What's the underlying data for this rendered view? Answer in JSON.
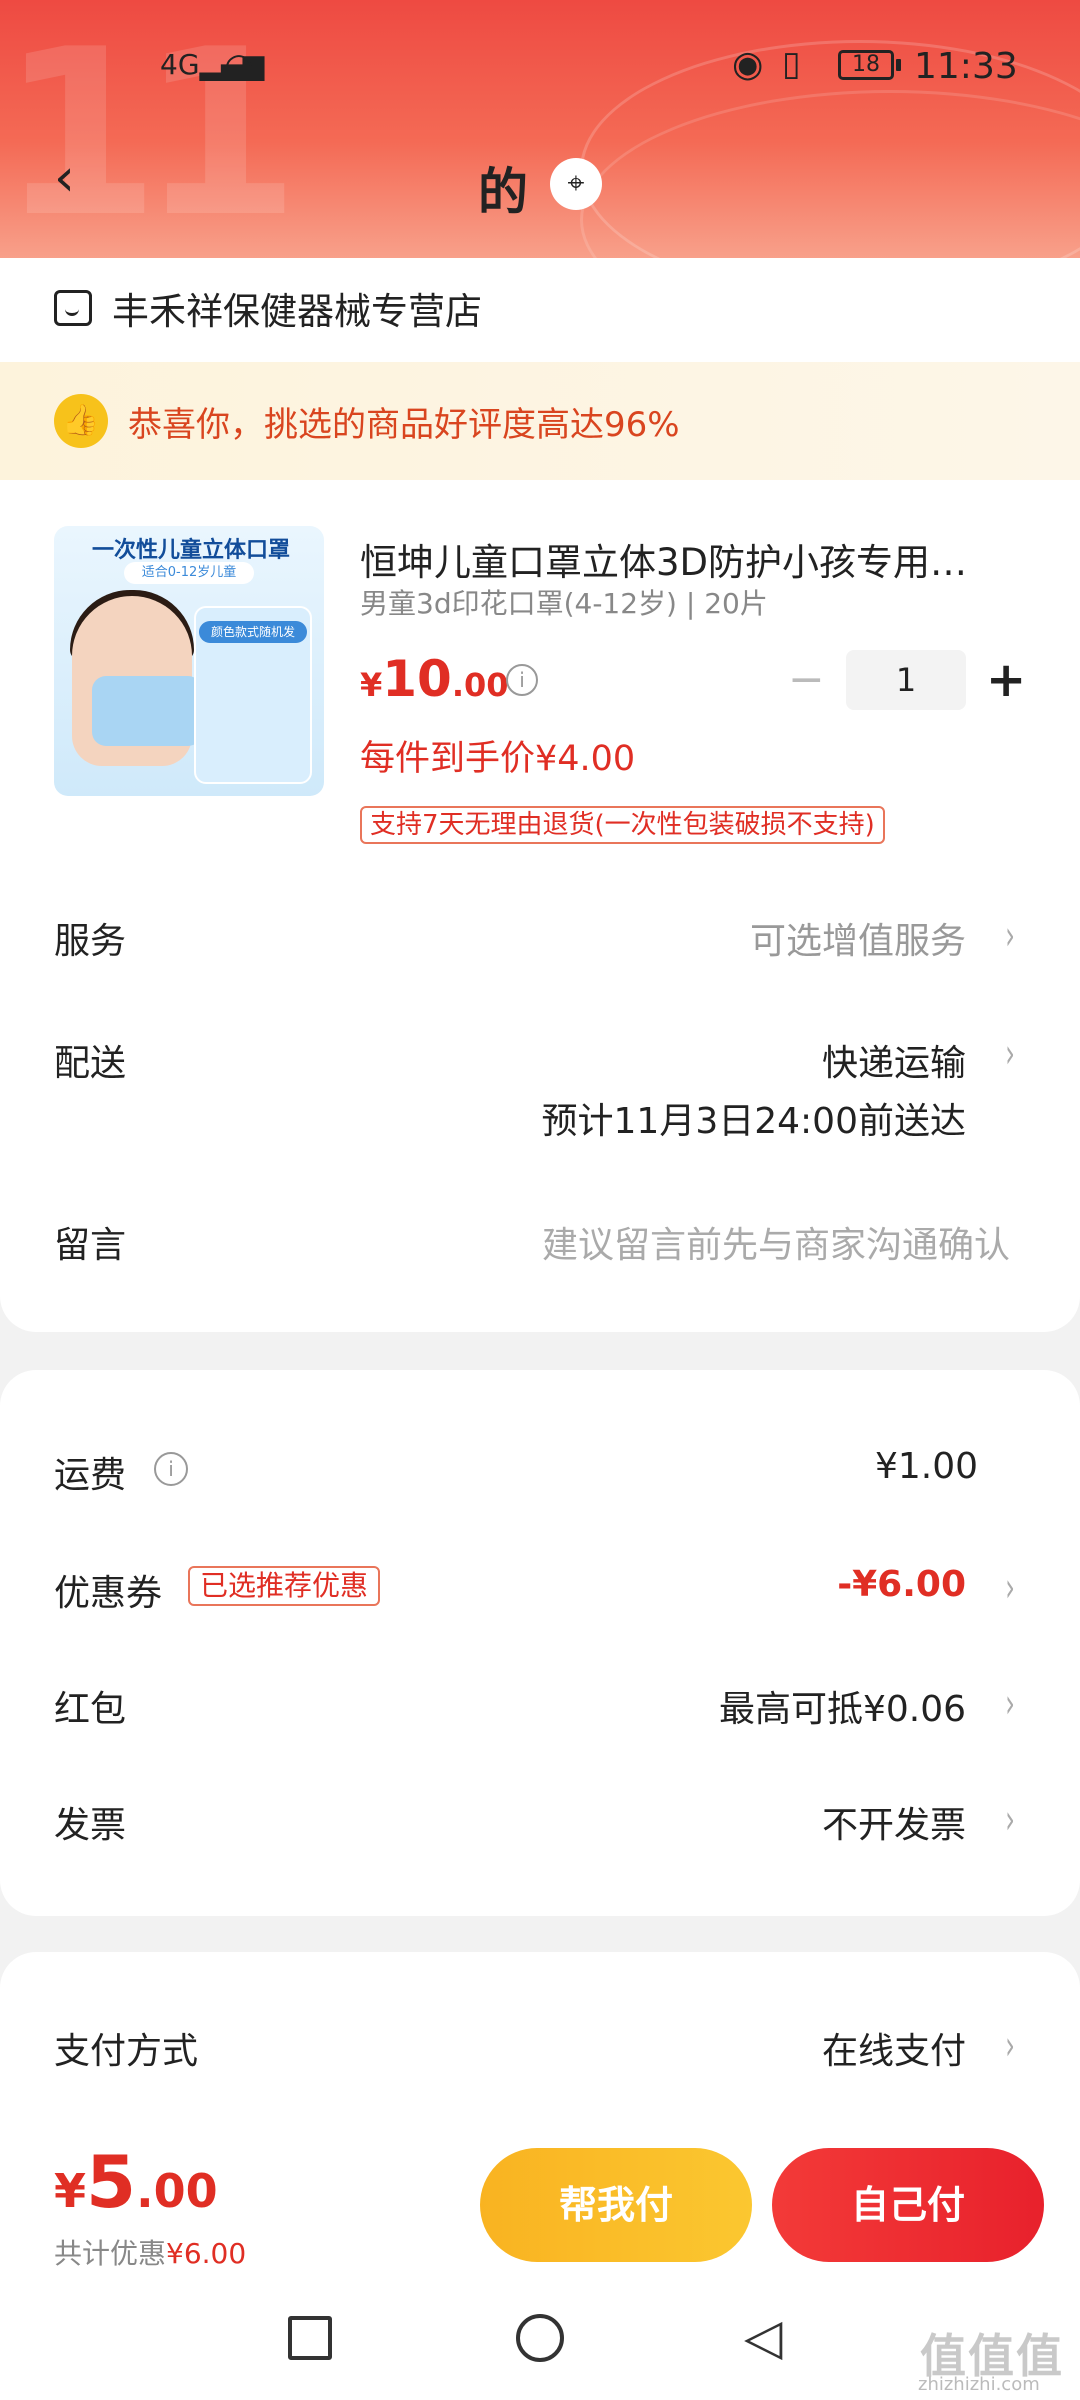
{
  "status_bar": {
    "network": "4G",
    "battery": "18",
    "time": "11:33"
  },
  "header": {
    "back_icon": "chevron-left-icon",
    "title": "的",
    "location_icon": "location-pin-icon"
  },
  "shop": {
    "name": "丰禾祥保健器械专营店"
  },
  "praise_banner": {
    "text": "恭喜你，挑选的商品好评度高达96%"
  },
  "product": {
    "image_heading": "一次性儿童立体口罩",
    "image_sub": "适合0-12岁儿童",
    "image_label": "颜色款式随机发",
    "name": "恒坤儿童口罩立体3D防护小孩专用…",
    "spec": "男童3d印花口罩(4-12岁) | 20片",
    "price_currency": "¥",
    "price_int": "10",
    "price_dec": ".00",
    "quantity": "1",
    "unit_price": "每件到手价¥4.00",
    "return_policy": "支持7天无理由退货(一次性包装破损不支持)"
  },
  "rows": {
    "service": {
      "label": "服务",
      "value": "可选增值服务"
    },
    "delivery": {
      "label": "配送",
      "value": "快递运输",
      "estimate": "预计11月3日24:00前送达"
    },
    "message": {
      "label": "留言",
      "placeholder": "建议留言前先与商家沟通确认"
    }
  },
  "fees": {
    "shipping": {
      "label": "运费",
      "value": "¥1.00"
    },
    "coupon": {
      "label": "优惠券",
      "tag": "已选推荐优惠",
      "value": "-¥6.00"
    },
    "red_packet": {
      "label": "红包",
      "value": "最高可抵¥0.06"
    },
    "invoice": {
      "label": "发票",
      "value": "不开发票"
    }
  },
  "payment": {
    "label": "支付方式",
    "value": "在线支付"
  },
  "checkout": {
    "currency": "¥",
    "total_int": "5",
    "total_dec": ".00",
    "saved_label": "共计优惠",
    "saved_value": "¥6.00",
    "help_pay": "帮我付",
    "self_pay": "自己付"
  },
  "watermark": {
    "logo": "值值值",
    "url": "zhizhizhi.com"
  },
  "colors": {
    "accent_red": "#e02e24",
    "header_red": "#ee4a42",
    "help_button": "#f9b321",
    "self_button": "#ee2a31"
  }
}
